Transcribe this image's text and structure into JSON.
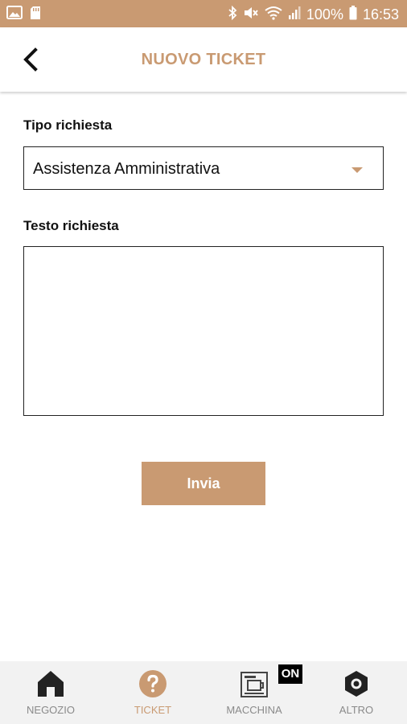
{
  "status_bar": {
    "battery": "100%",
    "time": "16:53",
    "icons": [
      "image-icon",
      "sd-card-icon",
      "bluetooth-icon",
      "mute-icon",
      "wifi-icon",
      "signal-icon",
      "battery-icon"
    ]
  },
  "header": {
    "title": "NUOVO TICKET",
    "back_icon": "chevron-left-icon"
  },
  "form": {
    "type_label": "Tipo richiesta",
    "type_value": "Assistenza Amministrativa",
    "text_label": "Testo richiesta",
    "text_value": "",
    "submit_label": "Invia"
  },
  "bottom_nav": {
    "items": [
      {
        "label": "NEGOZIO",
        "icon": "home-icon",
        "active": false
      },
      {
        "label": "TICKET",
        "icon": "help-circle-icon",
        "active": true
      },
      {
        "label": "MACCHINA",
        "icon": "coffee-machine-icon",
        "active": false
      },
      {
        "label": "ALTRO",
        "icon": "hex-nut-icon",
        "active": false
      }
    ],
    "badge": "ON"
  },
  "colors": {
    "accent": "#c99a72",
    "nav_inactive": "#8a8a8a",
    "nav_background": "#f2f2f2"
  }
}
